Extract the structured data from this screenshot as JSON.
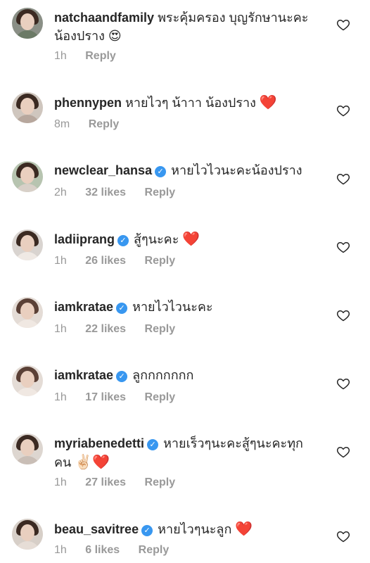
{
  "comments": [
    {
      "username": "natchaandfamily",
      "verified": false,
      "text": "พระคุ้มครอง บุญรักษานะคะน้องปราง",
      "emoji": "😍",
      "time": "1h",
      "likes": "",
      "reply": "Reply"
    },
    {
      "username": "phennypen",
      "verified": false,
      "text": "หายไวๆ น้าาา น้องปราง",
      "emoji": "❤️",
      "time": "8m",
      "likes": "",
      "reply": "Reply"
    },
    {
      "username": "newclear_hansa",
      "verified": true,
      "text": "หายไวไวนะคะน้องปราง",
      "emoji": "",
      "time": "2h",
      "likes": "32 likes",
      "reply": "Reply"
    },
    {
      "username": "ladiiprang",
      "verified": true,
      "text": "สู้ๆนะคะ",
      "emoji": "❤️",
      "time": "1h",
      "likes": "26 likes",
      "reply": "Reply"
    },
    {
      "username": "iamkratae",
      "verified": true,
      "text": "หายไวไวนะคะ",
      "emoji": "",
      "time": "1h",
      "likes": "22 likes",
      "reply": "Reply"
    },
    {
      "username": "iamkratae",
      "verified": true,
      "text": "ลูกกกกกกก",
      "emoji": "",
      "time": "1h",
      "likes": "17 likes",
      "reply": "Reply"
    },
    {
      "username": "myriabenedetti",
      "verified": true,
      "text": "หายเร็วๆนะคะสู้ๆนะคะทุกคน",
      "emoji": "✌🏻❤️",
      "time": "1h",
      "likes": "27 likes",
      "reply": "Reply"
    },
    {
      "username": "beau_savitree",
      "verified": true,
      "text": "หายไวๆนะลูก",
      "emoji": "❤️",
      "time": "1h",
      "likes": "6 likes",
      "reply": "Reply"
    }
  ],
  "icons": {
    "verified": "verified-badge-icon",
    "like": "heart-outline-icon"
  },
  "colors": {
    "verified": "#3897f0",
    "meta": "#999999",
    "text": "#262626"
  }
}
